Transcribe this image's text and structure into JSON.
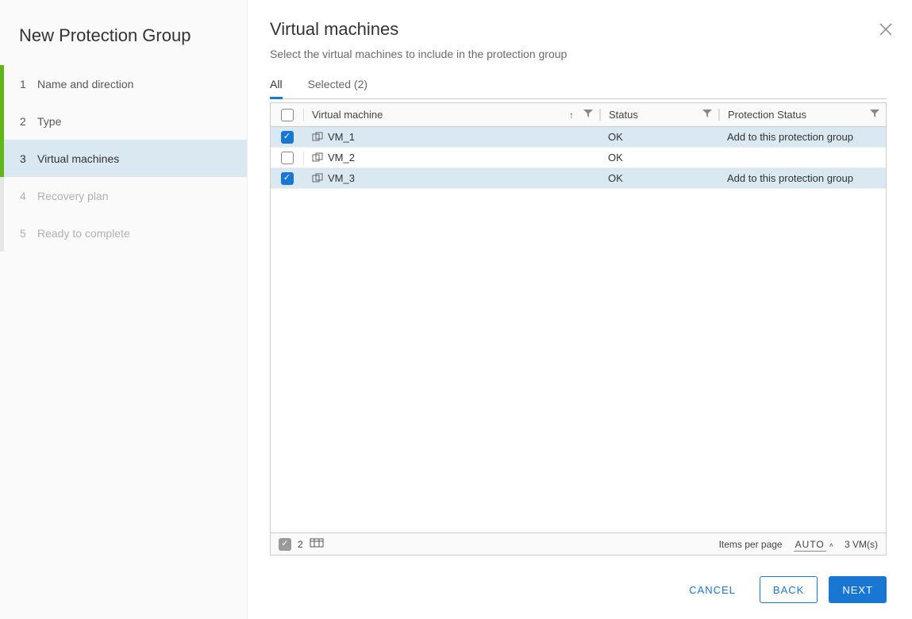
{
  "sidebar": {
    "title": "New Protection Group",
    "steps": [
      {
        "num": "1",
        "label": "Name and direction",
        "state": "done"
      },
      {
        "num": "2",
        "label": "Type",
        "state": "done"
      },
      {
        "num": "3",
        "label": "Virtual machines",
        "state": "current"
      },
      {
        "num": "4",
        "label": "Recovery plan",
        "state": "upcoming"
      },
      {
        "num": "5",
        "label": "Ready to complete",
        "state": "upcoming"
      }
    ]
  },
  "main": {
    "title": "Virtual machines",
    "subtitle": "Select the virtual machines to include in the protection group",
    "tabs": {
      "all": "All",
      "selected": "Selected (2)"
    },
    "table": {
      "headers": {
        "vm": "Virtual machine",
        "status": "Status",
        "prot": "Protection Status"
      },
      "rows": [
        {
          "checked": true,
          "name": "VM_1",
          "status": "OK",
          "prot": "Add to this protection group"
        },
        {
          "checked": false,
          "name": "VM_2",
          "status": "OK",
          "prot": ""
        },
        {
          "checked": true,
          "name": "VM_3",
          "status": "OK",
          "prot": "Add to this protection group"
        }
      ],
      "footer": {
        "selected_count": "2",
        "ipp_label": "Items per page",
        "ipp_value": "AUTO",
        "total": "3 VM(s)"
      }
    }
  },
  "footer": {
    "cancel": "CANCEL",
    "back": "BACK",
    "next": "NEXT"
  }
}
